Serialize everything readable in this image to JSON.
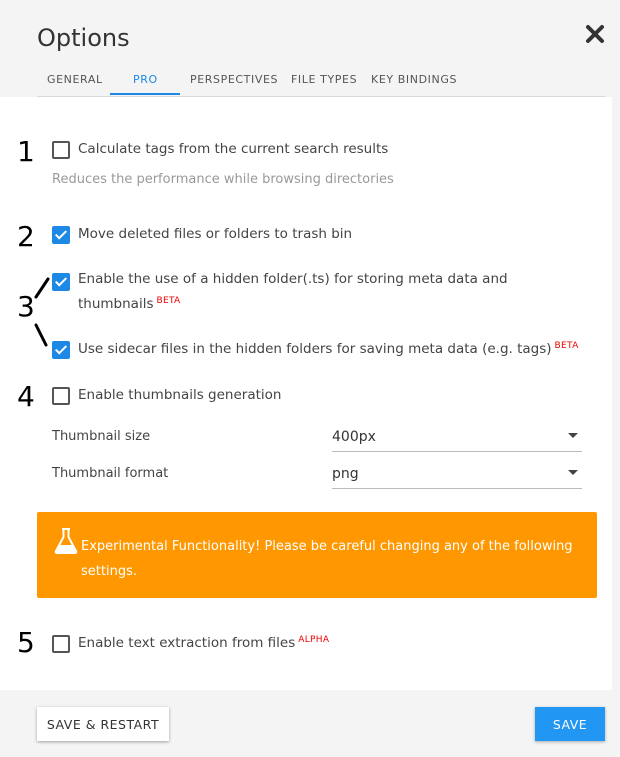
{
  "dialog": {
    "title": "Options",
    "close_icon": "close-icon"
  },
  "tabs": [
    {
      "label": "GENERAL",
      "active": false
    },
    {
      "label": "PRO",
      "active": true
    },
    {
      "label": "PERSPECTIVES",
      "active": false
    },
    {
      "label": "FILE TYPES",
      "active": false
    },
    {
      "label": "KEY BINDINGS",
      "active": false
    }
  ],
  "annotations": [
    "1",
    "2",
    "3",
    "4",
    "5"
  ],
  "options": {
    "calc_tags": {
      "label": "Calculate tags from the current search results",
      "checked": false,
      "hint": "Reduces the performance while browsing directories"
    },
    "trash": {
      "label": "Move deleted files or folders to trash bin",
      "checked": true
    },
    "hidden_folder": {
      "label_line1": "Enable the use of a hidden folder(.ts) for storing meta data and",
      "label_line2": "thumbnails",
      "badge": "BETA",
      "checked": true
    },
    "sidecar": {
      "label": "Use sidecar files in the hidden folders for saving meta data (e.g. tags)",
      "badge": "BETA",
      "checked": true
    },
    "thumbnails": {
      "label": "Enable thumbnails generation",
      "checked": false
    },
    "thumb_size": {
      "label": "Thumbnail size",
      "value": "400px"
    },
    "thumb_format": {
      "label": "Thumbnail format",
      "value": "png"
    },
    "warning": {
      "icon": "flask-icon",
      "text": "Experimental Functionality! Please be careful changing any of the following settings.",
      "color": "#ff9800"
    },
    "text_extraction": {
      "label": "Enable text extraction from files",
      "badge": "ALPHA",
      "checked": false
    }
  },
  "footer": {
    "restart_label": "SAVE & RESTART",
    "save_label": "SAVE"
  },
  "colors": {
    "accent": "#1e88e5",
    "badge": "#ee0000"
  }
}
